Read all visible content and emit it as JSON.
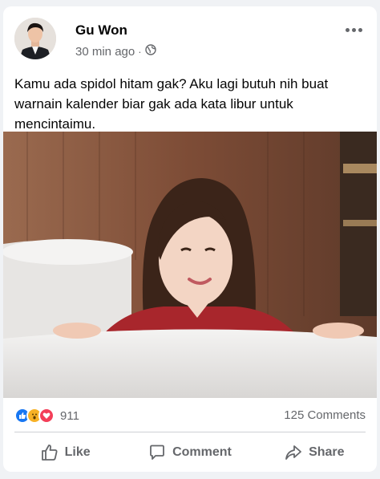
{
  "post": {
    "author": "Gu Won",
    "time": "30 min ago",
    "separator": "·",
    "privacy_icon": "globe-icon",
    "text": "Kamu ada spidol hitam gak? Aku lagi butuh nih buat warnain kalender biar gak ada kata libur untuk mencintaimu."
  },
  "reactions": {
    "icons": [
      "like-reaction-icon",
      "wow-reaction-icon",
      "love-reaction-icon"
    ],
    "count": "911",
    "comments": "125 Comments"
  },
  "actions": {
    "like": "Like",
    "comment": "Comment",
    "share": "Share"
  },
  "colors": {
    "like_blue": "#1877f2",
    "wow_yellow": "#f7b125",
    "love_red": "#f33e58",
    "meta_gray": "#65676b"
  }
}
